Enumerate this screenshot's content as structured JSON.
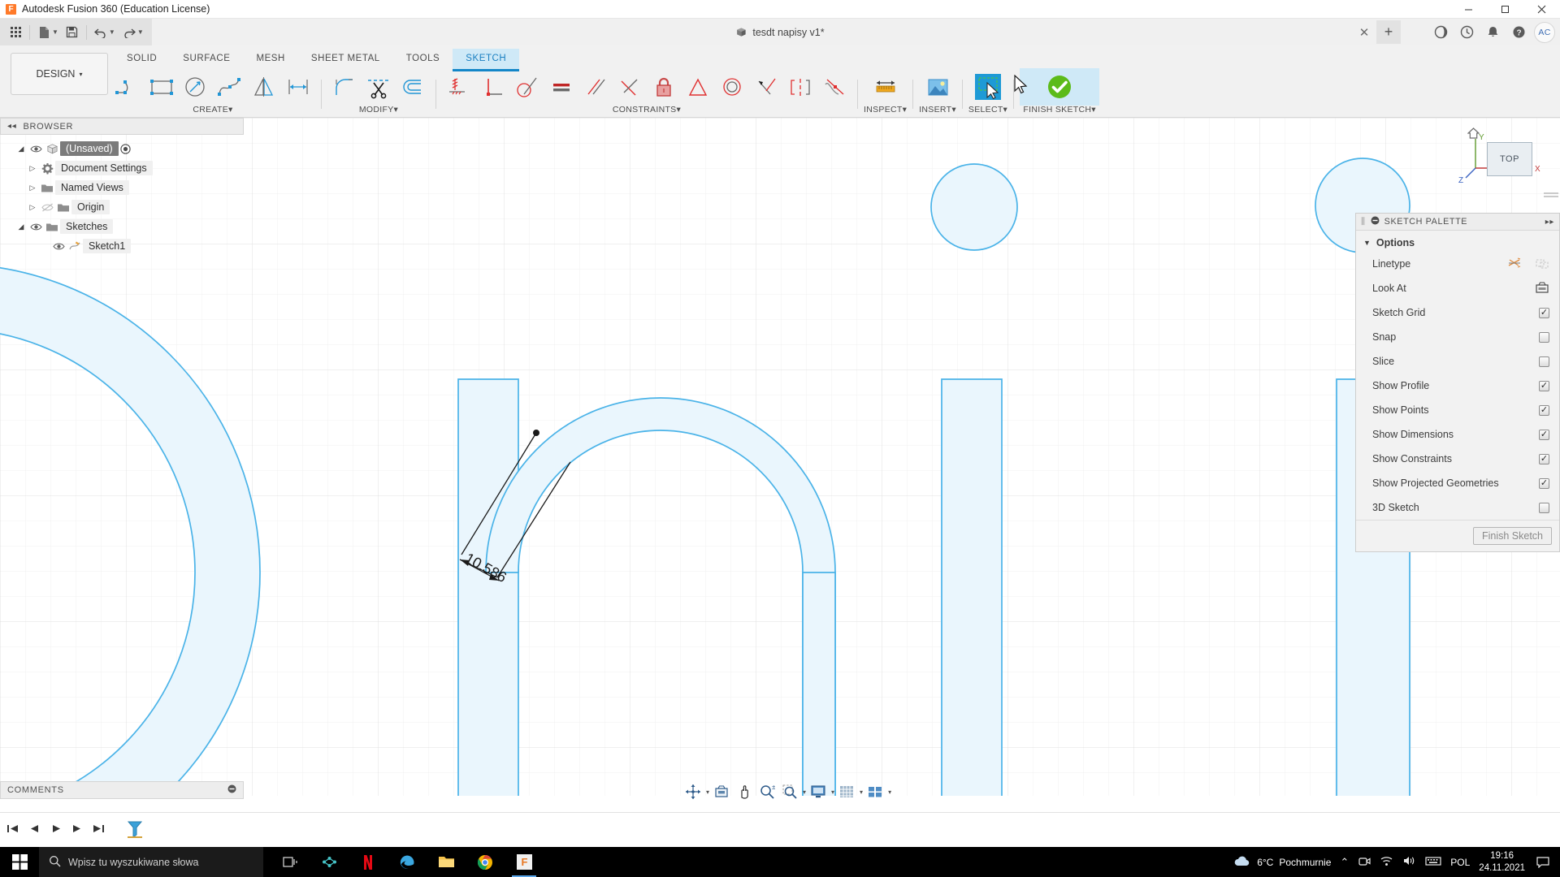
{
  "titlebar": {
    "app_title": "Autodesk Fusion 360 (Education License)",
    "logo_letter": "F",
    "minimize": "─",
    "maximize": "☐",
    "close": "✕"
  },
  "quick_access": {
    "grid_icon": "app-grid-icon",
    "new_icon": "new-document-icon",
    "save_icon": "save-icon",
    "undo_icon": "undo-icon",
    "redo_icon": "redo-icon",
    "caret": "▼",
    "document_tab": "tesdt napisy v1*",
    "tab_close": "✕",
    "tab_new": "+",
    "right_icons": [
      "data-panel-icon",
      "job-status-icon",
      "notifications-icon",
      "help-icon"
    ],
    "avatar_initials": "AC"
  },
  "ribbon": {
    "workspace": "DESIGN",
    "workspace_caret": "▾",
    "tabs": [
      {
        "label": "SOLID",
        "active": false
      },
      {
        "label": "SURFACE",
        "active": false
      },
      {
        "label": "MESH",
        "active": false
      },
      {
        "label": "SHEET METAL",
        "active": false
      },
      {
        "label": "TOOLS",
        "active": false
      },
      {
        "label": "SKETCH",
        "active": true
      }
    ],
    "groups": [
      {
        "label": "CREATE",
        "caret": "▾"
      },
      {
        "label": "MODIFY",
        "caret": "▾"
      },
      {
        "label": "CONSTRAINTS",
        "caret": "▾"
      },
      {
        "label": "INSPECT",
        "caret": "▾"
      },
      {
        "label": "INSERT",
        "caret": "▾"
      },
      {
        "label": "SELECT",
        "caret": "▾"
      },
      {
        "label": "FINISH SKETCH",
        "caret": "▾"
      }
    ]
  },
  "browser": {
    "title": "BROWSER",
    "collapse": "◂◂",
    "items": [
      {
        "label": "(Unsaved)",
        "selected": true,
        "expander": "◢",
        "eye": true
      },
      {
        "label": "Document Settings",
        "selected": false,
        "expander": "▷",
        "eye": false
      },
      {
        "label": "Named Views",
        "selected": false,
        "expander": "▷",
        "eye": false
      },
      {
        "label": "Origin",
        "selected": false,
        "expander": "▷",
        "eye": true,
        "eye_off": true
      },
      {
        "label": "Sketches",
        "selected": false,
        "expander": "◢",
        "eye": true
      },
      {
        "label": "Sketch1",
        "selected": false,
        "expander": "",
        "eye": true
      }
    ]
  },
  "sketch_palette": {
    "title": "SKETCH PALETTE",
    "pin": "▸▸",
    "section": "Options",
    "section_tri": "▼",
    "rows": [
      {
        "label": "Linetype",
        "control": "icon-pair"
      },
      {
        "label": "Look At",
        "control": "icon"
      },
      {
        "label": "Sketch Grid",
        "control": "checkbox",
        "checked": true
      },
      {
        "label": "Snap",
        "control": "checkbox",
        "checked": false
      },
      {
        "label": "Slice",
        "control": "checkbox",
        "checked": false
      },
      {
        "label": "Show Profile",
        "control": "checkbox",
        "checked": true
      },
      {
        "label": "Show Points",
        "control": "checkbox",
        "checked": true
      },
      {
        "label": "Show Dimensions",
        "control": "checkbox",
        "checked": true
      },
      {
        "label": "Show Constraints",
        "control": "checkbox",
        "checked": true
      },
      {
        "label": "Show Projected Geometries",
        "control": "checkbox",
        "checked": true
      },
      {
        "label": "3D Sketch",
        "control": "checkbox",
        "checked": false
      }
    ],
    "finish_button": "Finish Sketch",
    "check_glyph": "✓"
  },
  "viewcube": {
    "face_label": "TOP",
    "axis_x": "X",
    "axis_y": "Y",
    "axis_z": "Z",
    "home_icon": "home-icon"
  },
  "canvas": {
    "dimension_value": "10.586",
    "sketch_line_color": "#4ab3e8",
    "profile_fill": "#eaf6fd",
    "dimension_color": "#1a1a1a"
  },
  "comments": {
    "title": "COMMENTS"
  },
  "navbar": {
    "buttons": [
      "orbit-icon",
      "look-at-icon",
      "pan-icon",
      "zoom-icon",
      "zoom-window-icon",
      "display-settings-icon",
      "grid-snaps-icon",
      "viewports-icon"
    ],
    "caret": "▾"
  },
  "timeline": {
    "buttons": [
      "go-to-beginning-icon",
      "step-back-icon",
      "play-icon",
      "step-forward-icon",
      "go-to-end-icon"
    ],
    "marker": "sketch1-timeline-marker"
  },
  "taskbar": {
    "start_icon": "windows-start-icon",
    "search_placeholder": "Wpisz tu wyszukiwane słowa",
    "search_icon": "search-icon",
    "apps": [
      {
        "name": "task-view-icon"
      },
      {
        "name": "cisco-webex-icon"
      },
      {
        "name": "netflix-icon"
      },
      {
        "name": "edge-icon"
      },
      {
        "name": "file-explorer-icon"
      },
      {
        "name": "chrome-icon"
      },
      {
        "name": "fusion360-icon",
        "active": true
      }
    ],
    "weather_temp": "6°C",
    "weather_text": "Pochmurnie",
    "tray_expand": "⌃",
    "tray_icons": [
      "camera-icon",
      "wifi-icon",
      "volume-icon",
      "keyboard-icon"
    ],
    "language": "POL",
    "time": "19:16",
    "date": "24.11.2021",
    "action_center": "notification-icon"
  }
}
